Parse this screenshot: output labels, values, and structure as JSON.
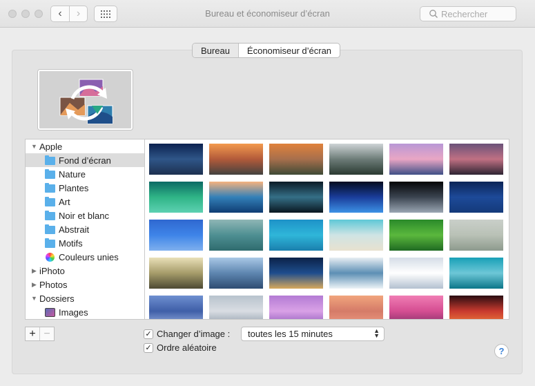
{
  "window": {
    "title": "Bureau et économiseur d’écran",
    "search_placeholder": "Rechercher"
  },
  "tabs": [
    {
      "label": "Bureau",
      "active": true
    },
    {
      "label": "Économiseur d’écran",
      "active": false
    }
  ],
  "sidebar": {
    "items": [
      {
        "label": "Apple",
        "type": "group",
        "expanded": true
      },
      {
        "label": "Fond d’écran",
        "type": "folder",
        "selected": true
      },
      {
        "label": "Nature",
        "type": "folder"
      },
      {
        "label": "Plantes",
        "type": "folder"
      },
      {
        "label": "Art",
        "type": "folder"
      },
      {
        "label": "Noir et blanc",
        "type": "folder"
      },
      {
        "label": "Abstrait",
        "type": "folder"
      },
      {
        "label": "Motifs",
        "type": "folder"
      },
      {
        "label": "Couleurs unies",
        "type": "colors"
      },
      {
        "label": "iPhoto",
        "type": "group",
        "expanded": false
      },
      {
        "label": "Photos",
        "type": "group",
        "expanded": false
      },
      {
        "label": "Dossiers",
        "type": "group",
        "expanded": true
      },
      {
        "label": "Images",
        "type": "images"
      }
    ]
  },
  "wallpapers": [
    {
      "name": "yosemite-night",
      "colors": [
        "#0c2250",
        "#2f5688",
        "#1d3050"
      ]
    },
    {
      "name": "el-capitan-sunset",
      "colors": [
        "#f39a4e",
        "#b25a3a",
        "#43423f"
      ]
    },
    {
      "name": "yosemite-valley-sunset",
      "colors": [
        "#e0823c",
        "#a76f4c",
        "#3f4a36"
      ]
    },
    {
      "name": "forest-mist",
      "colors": [
        "#ced4d6",
        "#6d7c78",
        "#2a3a31"
      ]
    },
    {
      "name": "half-dome-pink",
      "colors": [
        "#b997d6",
        "#e9a6c4",
        "#3f4f86"
      ]
    },
    {
      "name": "lake-rocks-dusk",
      "colors": [
        "#6a5279",
        "#c07083",
        "#2e2432"
      ]
    },
    {
      "name": "green-wave",
      "colors": [
        "#0b6a64",
        "#2fb486",
        "#5dd1b2"
      ]
    },
    {
      "name": "ocean-wave",
      "colors": [
        "#f5b27f",
        "#3380b8",
        "#0f3c73"
      ]
    },
    {
      "name": "galaxy",
      "colors": [
        "#0b1b26",
        "#356f87",
        "#0a1720"
      ]
    },
    {
      "name": "earth-horizon-blue",
      "colors": [
        "#040c1f",
        "#1a3d9a",
        "#3d92e6"
      ]
    },
    {
      "name": "earth-from-space",
      "colors": [
        "#050608",
        "#3b4450",
        "#9aa6b3"
      ]
    },
    {
      "name": "starry-blue",
      "colors": [
        "#0b2457",
        "#1d4a99",
        "#143a7a"
      ]
    },
    {
      "name": "blue-sky-moon",
      "colors": [
        "#2f68d0",
        "#3e84e8",
        "#7fb0ee"
      ]
    },
    {
      "name": "teal-clouds",
      "colors": [
        "#8fb6b5",
        "#4e8f92",
        "#2f6b6e"
      ]
    },
    {
      "name": "blue-water",
      "colors": [
        "#1d92c8",
        "#2fb6d9",
        "#1a7fad"
      ]
    },
    {
      "name": "sandy-shore",
      "colors": [
        "#5ec8d6",
        "#cfe4e4",
        "#e8e1cf"
      ]
    },
    {
      "name": "green-fields",
      "colors": [
        "#2a8a2a",
        "#5bb83d",
        "#1f6a22"
      ]
    },
    {
      "name": "foggy-coast",
      "colors": [
        "#c9cfc9",
        "#b9c1b6",
        "#8d9a8d"
      ]
    },
    {
      "name": "misty-trees",
      "colors": [
        "#e9e0b8",
        "#a69c6a",
        "#4d4a33"
      ]
    },
    {
      "name": "blue-mountains",
      "colors": [
        "#a9c8e6",
        "#5e86b0",
        "#2e4c72"
      ]
    },
    {
      "name": "night-city-lights",
      "colors": [
        "#0b2248",
        "#1e4d8d",
        "#d7a85c"
      ]
    },
    {
      "name": "ice-cracks",
      "colors": [
        "#e7eef3",
        "#5d8fb4",
        "#edf3f7"
      ]
    },
    {
      "name": "snow-dunes",
      "colors": [
        "#d5dde7",
        "#ffffff",
        "#b3c0d0"
      ]
    },
    {
      "name": "frozen-lake-trees",
      "colors": [
        "#18a0b7",
        "#6dc7d7",
        "#0c7689"
      ]
    },
    {
      "name": "blue-ice-texture",
      "colors": [
        "#6e8fd0",
        "#3f5fa8",
        "#9bb3e3"
      ]
    },
    {
      "name": "misty-lake",
      "colors": [
        "#b8c3cd",
        "#d9dde3",
        "#8a98a6"
      ]
    },
    {
      "name": "purple-clouds",
      "colors": [
        "#b37bd4",
        "#d9a1e6",
        "#8a55b8"
      ]
    },
    {
      "name": "pink-sand",
      "colors": [
        "#f1a57d",
        "#d57b68",
        "#ef9c82"
      ]
    },
    {
      "name": "mount-fuji-pink",
      "colors": [
        "#f07db4",
        "#d54e92",
        "#7e2d66"
      ]
    },
    {
      "name": "red-canyon",
      "colors": [
        "#2a0d11",
        "#c83a2f",
        "#f2873e"
      ]
    }
  ],
  "options": {
    "change_image_label": "Changer d’image :",
    "change_image_checked": true,
    "interval": "toutes les 15 minutes",
    "random_label": "Ordre aléatoire",
    "random_checked": true
  },
  "controls": {
    "add": "+",
    "remove": "−",
    "help": "?"
  }
}
